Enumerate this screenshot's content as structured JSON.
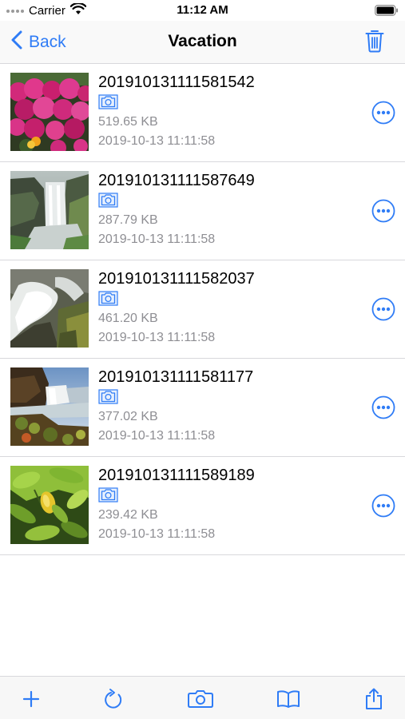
{
  "status_bar": {
    "carrier": "Carrier",
    "time": "11:12 AM"
  },
  "nav": {
    "back_label": "Back",
    "title": "Vacation"
  },
  "files": [
    {
      "name": "201910131111581542",
      "size": "519.65 KB",
      "date": "2019-10-13 11:11:58",
      "type_icon": "camera-icon",
      "thumbnail": "pink-flowers"
    },
    {
      "name": "201910131111587649",
      "size": "287.79 KB",
      "date": "2019-10-13 11:11:58",
      "type_icon": "camera-icon",
      "thumbnail": "waterfall-cliff"
    },
    {
      "name": "201910131111582037",
      "size": "461.20 KB",
      "date": "2019-10-13 11:11:58",
      "type_icon": "camera-icon",
      "thumbnail": "waterfall-closeup"
    },
    {
      "name": "201910131111581177",
      "size": "377.02 KB",
      "date": "2019-10-13 11:11:58",
      "type_icon": "camera-icon",
      "thumbnail": "waterfall-sunset"
    },
    {
      "name": "201910131111589189",
      "size": "239.42 KB",
      "date": "2019-10-13 11:11:58",
      "type_icon": "camera-icon",
      "thumbnail": "lemon-leaves"
    }
  ],
  "toolbar": {
    "items": [
      "plus-icon",
      "refresh-icon",
      "camera-icon",
      "book-icon",
      "share-icon"
    ]
  },
  "colors": {
    "accent": "#2f7cf6",
    "secondary_text": "#8e8e93",
    "separator": "#d8d8dc"
  }
}
